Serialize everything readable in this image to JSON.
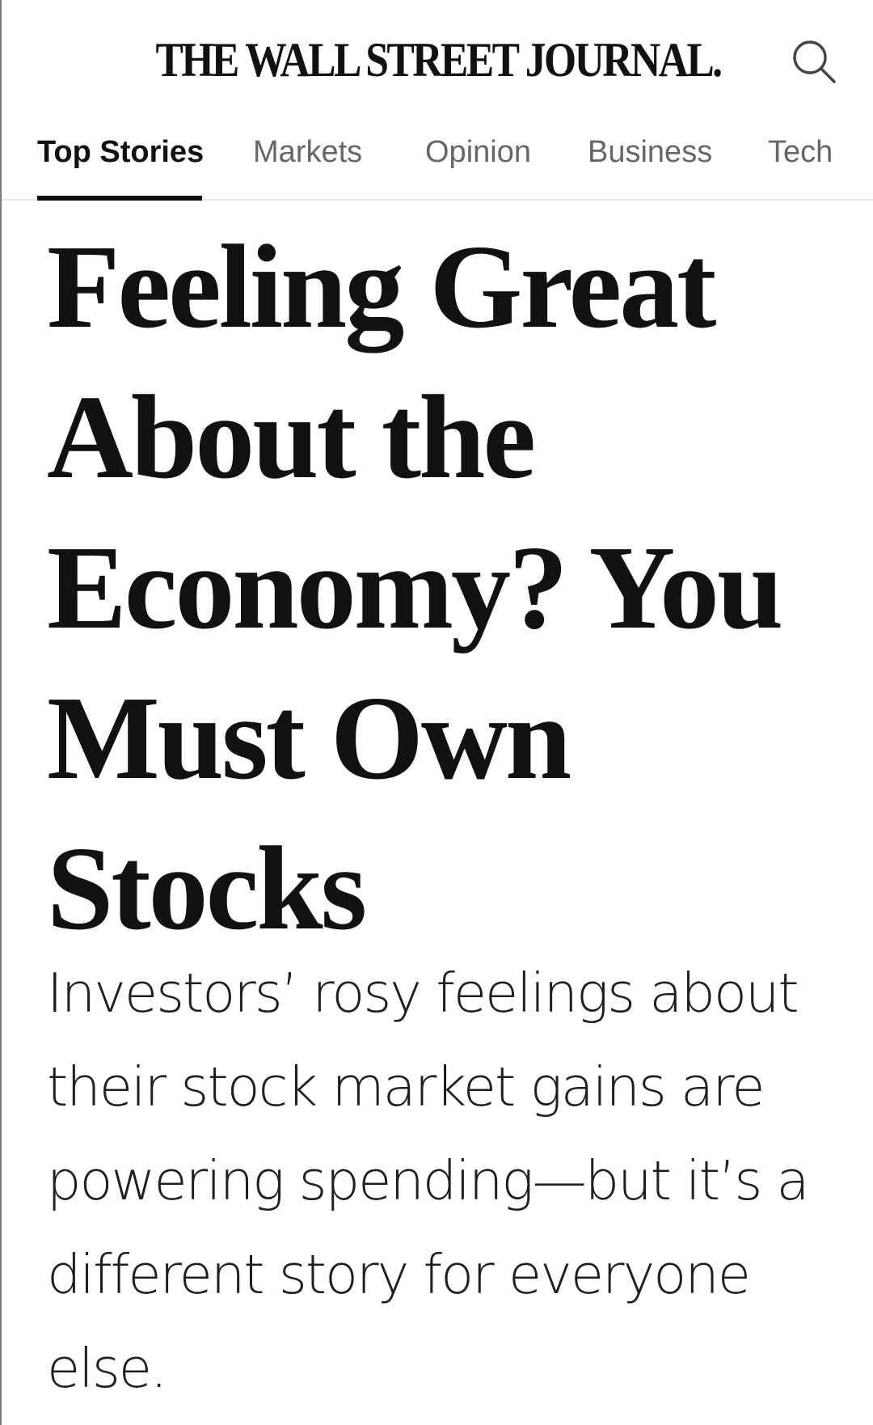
{
  "masthead": {
    "title": "THE WALL STREET JOURNAL.",
    "search_icon": "search-icon"
  },
  "nav": {
    "tabs": [
      {
        "label": "Top Stories",
        "active": true
      },
      {
        "label": "Markets",
        "active": false
      },
      {
        "label": "Opinion",
        "active": false
      },
      {
        "label": "Business",
        "active": false
      },
      {
        "label": "Tech",
        "active": false
      }
    ]
  },
  "article": {
    "headline": "Feeling Great About the Economy? You Must Own Stocks",
    "dek": "Investors’ rosy feelings about their stock market gains are powering spending—but it’s a different story for everyone else."
  },
  "colors": {
    "text": "#111111",
    "nav_inactive": "#666666",
    "divider": "#e6e6e6",
    "background": "#ffffff"
  }
}
